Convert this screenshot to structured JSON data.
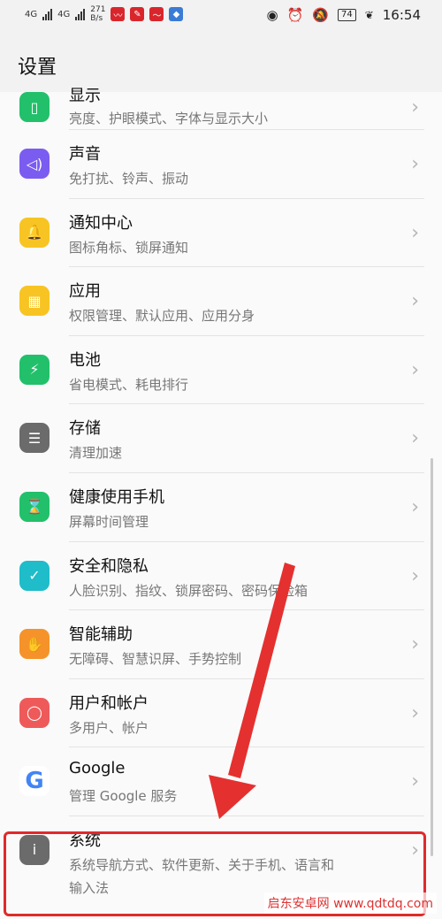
{
  "status_bar": {
    "net_left": "4G",
    "net_right": "4G",
    "speed_value": "271",
    "speed_unit": "B/s",
    "battery": "74",
    "time": "16:54"
  },
  "header": {
    "title": "设置"
  },
  "settings_items": [
    {
      "name": "display",
      "title": "显示",
      "subtitle": "亮度、护眼模式、字体与显示大小",
      "icon": "display-icon",
      "color": "#22c06a"
    },
    {
      "name": "sound",
      "title": "声音",
      "subtitle": "免打扰、铃声、振动",
      "icon": "speaker-icon",
      "color": "#7b5cf0"
    },
    {
      "name": "notification",
      "title": "通知中心",
      "subtitle": "图标角标、锁屏通知",
      "icon": "bell-icon",
      "color": "#f7c423"
    },
    {
      "name": "apps",
      "title": "应用",
      "subtitle": "权限管理、默认应用、应用分身",
      "icon": "apps-icon",
      "color": "#f7c423"
    },
    {
      "name": "battery",
      "title": "电池",
      "subtitle": "省电模式、耗电排行",
      "icon": "battery-icon",
      "color": "#22c06a"
    },
    {
      "name": "storage",
      "title": "存储",
      "subtitle": "清理加速",
      "icon": "storage-icon",
      "color": "#6b6b6b"
    },
    {
      "name": "digital-balance",
      "title": "健康使用手机",
      "subtitle": "屏幕时间管理",
      "icon": "hourglass-icon",
      "color": "#22c06a"
    },
    {
      "name": "security",
      "title": "安全和隐私",
      "subtitle": "人脸识别、指纹、锁屏密码、密码保险箱",
      "icon": "shield-icon",
      "color": "#1fbcc9"
    },
    {
      "name": "accessibility",
      "title": "智能辅助",
      "subtitle": "无障碍、智慧识屏、手势控制",
      "icon": "hand-icon",
      "color": "#f5932a"
    },
    {
      "name": "users",
      "title": "用户和帐户",
      "subtitle": "多用户、帐户",
      "icon": "user-icon",
      "color": "#ee5a5a"
    },
    {
      "name": "google",
      "title": "Google",
      "subtitle": "管理 Google 服务",
      "icon": "google-icon",
      "color": "#ffffff"
    },
    {
      "name": "system",
      "title": "系统",
      "subtitle": "系统导航方式、软件更新、关于手机、语言和",
      "subtitle2": "输入法",
      "icon": "info-icon",
      "color": "#6b6b6b"
    }
  ],
  "watermark": "启东安卓网 www.qdtdq.com",
  "annotation": {
    "arrow_color": "#e53030",
    "highlight_color": "#e02a2a"
  }
}
